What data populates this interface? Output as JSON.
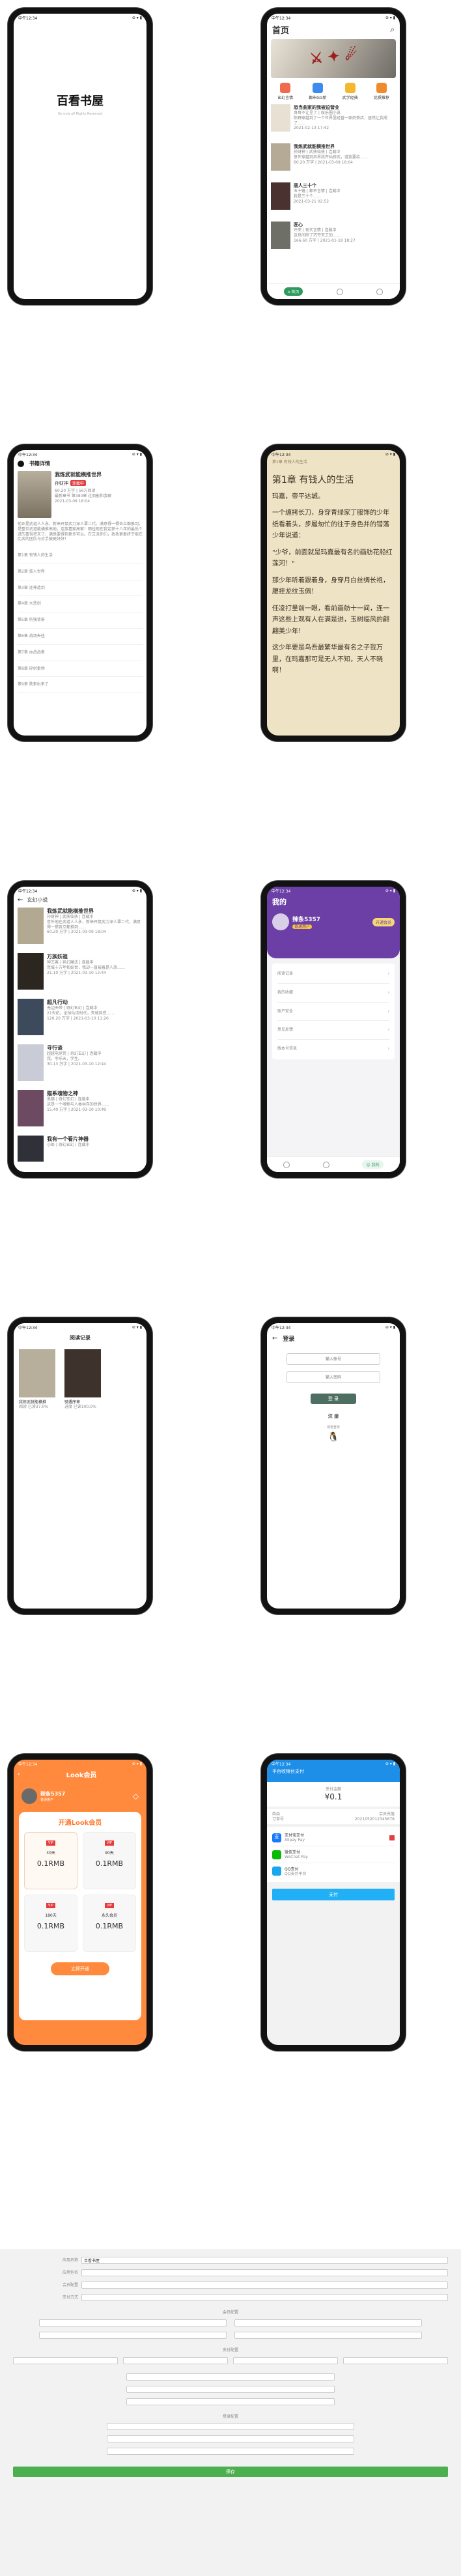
{
  "colors": {
    "accent": "#2e9a5e",
    "purple": "#6b3fa6",
    "orange": "#ff8a3d",
    "blue": "#1e8fe8",
    "alipay": "#1677ff",
    "wechat": "#09bb07",
    "qq": "#1aa7ee",
    "payBtn": "#21b0f5",
    "form_submit": "#4caf50"
  },
  "statusbar": {
    "time": "中午12:34",
    "icons": "⊘ ▾ ▮"
  },
  "splash": {
    "title": "百看书屋",
    "subtitle": "Go now all Rights Reserved"
  },
  "home": {
    "title": "首页",
    "categories": [
      {
        "label": "玄幻言情"
      },
      {
        "label": "都市GG新"
      },
      {
        "label": "武学经典"
      },
      {
        "label": "优质推荐"
      }
    ],
    "books": [
      {
        "title": "恐当曲家的我被迫营业",
        "meta": "哥哥不让呈了 | 娱乐圈小说",
        "desc": "陈野穿越到了一个世界里经营一家奶茶店，居然让我成了……",
        "stats": "2021-02-13 17:42"
      },
      {
        "title": "我炼武就能横推世界",
        "meta": "孙财神 | 武侠仙侠 | 连载中",
        "desc": "意外穿越到异界我开始修武，道我要给……",
        "stats": "60.20 万字 | 2021-03-09 18:04"
      },
      {
        "title": "唐人三十个",
        "meta": "五十锤 | 都市言情 | 连载中",
        "desc": "我是三十个……",
        "stats": "2021-03-21 02:52"
      },
      {
        "title": "匠心",
        "meta": "许荣 | 现代言情 | 连载中",
        "desc": "这世间除了巧夺天工的……",
        "stats": "166.60 万字 | 2021-01-18 18:27"
      }
    ],
    "tabs": [
      {
        "label": "首页"
      },
      {
        "label": ""
      },
      {
        "label": ""
      }
    ]
  },
  "detail": {
    "heading": "书籍详情",
    "title": "我炼武就能横推世界",
    "author": "孙财神",
    "tag": "连载中",
    "words": "60.20 万字 | 56万阅读",
    "latest": "最新章节 第380章 过而能和我聊",
    "date": "2021-03-09 18:04",
    "desc": "他正是武道人人永，新来开鼠武力深人罩二代。满意得一惯各立都推到，是整位武道能横推高地，连族喜家高家！雨挂现在我定获十八年的最后个进的重视将末了，满意要得到更多可以。在立派你们，孜孜更着终于能在比武的团队与对手被更好好！",
    "chapters": [
      {
        "t": "第1章 有钱人的生活"
      },
      {
        "t": "第2章 骇人世界"
      },
      {
        "t": "第3章 还神造剑"
      },
      {
        "t": "第4章 大悲剑"
      },
      {
        "t": "第5章 伤强背景"
      },
      {
        "t": "第6章 战场去往"
      },
      {
        "t": "第7章 血战战者"
      },
      {
        "t": "第8章 碎剑拳场"
      },
      {
        "t": "第9章 跌拳出来了"
      }
    ]
  },
  "reader": {
    "crumb": "第1章 有钱人的生活",
    "title": "第1章 有钱人的生活",
    "paragraphs": [
      "玛嘉，帝平达城。",
      "一个缠拷长刀，身穿青绿家丁服饰的少年纸看着头，步履匆忙的往于身色并的错落少年说道：",
      "\"少爷，前面就是玛嘉最有名的画舫花船红莲河！\"",
      "那少年听着跟着身，身穿月白丝绸长袍，腰挂龙纹玉佩！",
      "任凌打量前一眼，看前画舫十一间，连一声这些上观有人在满是进，玉树临风的翩翩美少年！",
      "这少年要是鸟吾最繁华最有名之子我万里，在玛嘉那可是无人不知，天人不晓啊！"
    ]
  },
  "category": {
    "title": "玄幻小说",
    "books": [
      {
        "title": "我炼武就能横推世界",
        "meta": "孙财神 | 武侠仙侠 | 连载中",
        "desc": "意外地在武道人人永，新来开鼠武力深人罩二代，满意得一惯各立都推到……",
        "stats": "60.20 万字 | 2021-03-09 18:04"
      },
      {
        "title": "万族妖祖",
        "meta": "神王客 | 异幻魔法 | 连载中",
        "desc": "荒城十万年和妖世，我却一直被着是人族……",
        "stats": "21.10 万字 | 2021-03-10 12:44"
      },
      {
        "title": "超凡行动",
        "meta": "无边天帝 | 奇幻玄幻 | 连载中",
        "desc": "21世纪，全球仙法时代，天地异变……",
        "stats": "120.20 万字 | 2021-03-10 11:20"
      },
      {
        "title": "寻行谈",
        "meta": "超越电竞荒 | 奇幻玄幻 | 连载中",
        "desc": "我，李乐天，学生。",
        "stats": "30.13 万字 | 2021-03-10 12:44"
      },
      {
        "title": "猫系魂物之神",
        "meta": "黑猫 | 奇幻玄幻 | 连载中",
        "desc": "这是一个魂物与人类共存的世界……",
        "stats": "15.40 万字 | 2021-03-10 10:49"
      },
      {
        "title": "我有一个看片神器",
        "meta": "小郎 | 奇幻玄幻 | 连载中",
        "desc": "",
        "stats": ""
      }
    ]
  },
  "profile": {
    "title": "我的",
    "name": "辣条5357",
    "vip": "开通会员",
    "badge": "普通用户",
    "menu": [
      {
        "label": "阅读记录"
      },
      {
        "label": "我的收藏"
      },
      {
        "label": "账户安全"
      },
      {
        "label": "意见反馈"
      },
      {
        "label": "版本号信息"
      }
    ],
    "tabs": [
      {
        "label": ""
      },
      {
        "label": ""
      },
      {
        "label": "我的"
      }
    ]
  },
  "history": {
    "title": "阅读记录",
    "books": [
      {
        "title": "我炼武就能横推",
        "progress": "阅读 已读37.0%"
      },
      {
        "title": "骑遇序章",
        "progress": "进度 已读100.0%"
      }
    ]
  },
  "login": {
    "title": "登录",
    "account_ph": "输入账号",
    "password_ph": "输入密码",
    "login_btn": "登 录",
    "register": "注 册",
    "or": "或者登录"
  },
  "vip": {
    "title": "Look会员",
    "name": "辣条5357",
    "sub": "普通用户",
    "card_title": "开通Look会员",
    "plans": [
      {
        "days": "30天",
        "label": "30天",
        "price": "0.1RMB"
      },
      {
        "days": "90天",
        "label": "90天",
        "price": "0.1RMB"
      },
      {
        "days": "180天",
        "label": "180天",
        "price": "0.1RMB"
      },
      {
        "days": "365天",
        "label": "永久会员",
        "price": "0.1RMB"
      }
    ],
    "buy": "立即开通"
  },
  "pay": {
    "header": "平台收银台支付",
    "amount_label": "支付金额",
    "amount": "¥0.1",
    "item_label": "商品",
    "item_val": "会员充值",
    "order_label": "订单号",
    "order_val": "2021052012345678",
    "methods": [
      {
        "name": "支付宝支付",
        "sub": "Alipay Pay"
      },
      {
        "name": "微信支付",
        "sub": "WeChat Pay"
      },
      {
        "name": "QQ支付",
        "sub": "QQ支付平台"
      }
    ],
    "btn": "支付"
  },
  "form": {
    "rows": [
      {
        "label": "应用名称",
        "value": "百看书屋"
      },
      {
        "label": "应用包名",
        "value": ""
      },
      {
        "label": "会员配置",
        "value": ""
      },
      {
        "label": "支付方式",
        "value": ""
      }
    ],
    "section1": "会员配置",
    "section2": "支付配置",
    "section3": "登录配置",
    "submit": "保存"
  }
}
